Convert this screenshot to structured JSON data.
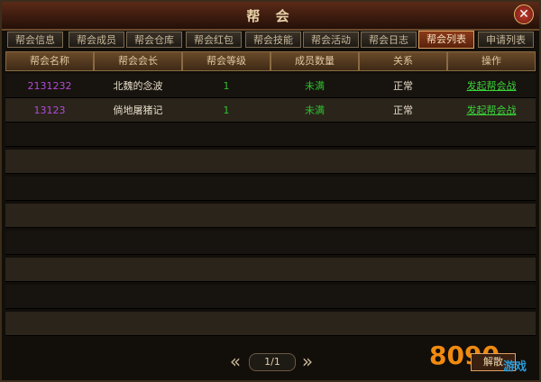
{
  "window": {
    "title": "帮 会",
    "close_icon": "close-icon"
  },
  "tabs": [
    {
      "label": "帮会信息",
      "active": false
    },
    {
      "label": "帮会成员",
      "active": false
    },
    {
      "label": "帮会仓库",
      "active": false
    },
    {
      "label": "帮会红包",
      "active": false
    },
    {
      "label": "帮会技能",
      "active": false
    },
    {
      "label": "帮会活动",
      "active": false
    },
    {
      "label": "帮会日志",
      "active": false
    },
    {
      "label": "帮会列表",
      "active": true
    },
    {
      "label": "申请列表",
      "active": false
    }
  ],
  "table": {
    "columns": [
      "帮会名称",
      "帮会会长",
      "帮会等级",
      "成员数量",
      "关系",
      "操作"
    ],
    "rows": [
      [
        "2131232",
        "北魏的念波",
        "1",
        "未满",
        "正常",
        "发起帮会战"
      ],
      [
        "13123",
        "倘地屠猪记",
        "1",
        "未满",
        "正常",
        "发起帮会战"
      ]
    ]
  },
  "pager": {
    "value": "1/1",
    "prev_icon": "double-left-arrow-icon",
    "next_icon": "double-right-arrow-icon"
  },
  "watermark": {
    "number": "8090",
    "button": "解散",
    "word": "游戏"
  }
}
